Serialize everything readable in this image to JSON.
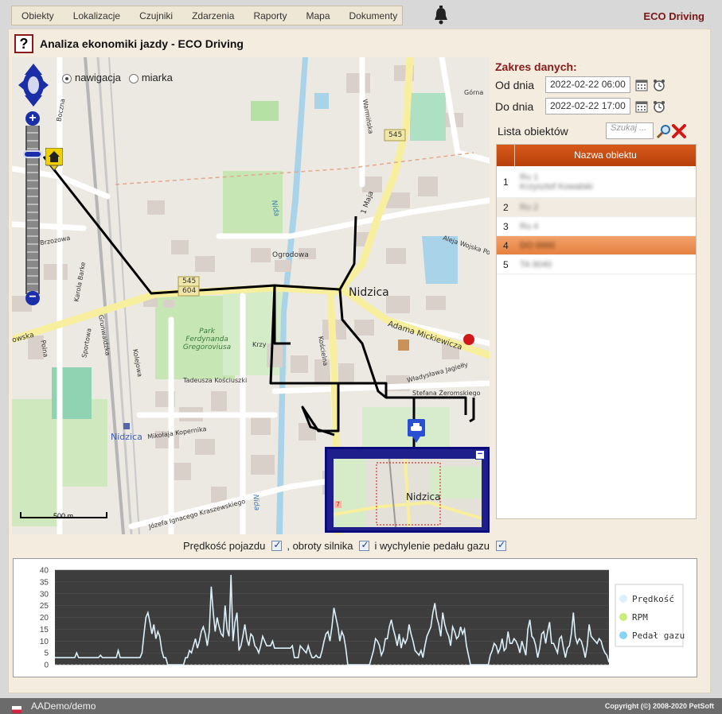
{
  "menu": {
    "items": [
      "Obiekty",
      "Lokalizacje",
      "Czujniki",
      "Zdarzenia",
      "Raporty",
      "Mapa",
      "Dokumenty"
    ]
  },
  "app_name": "ECO Driving",
  "page": {
    "help": "?",
    "title": "Analiza ekonomiki jazdy - ECO Driving"
  },
  "map": {
    "mode_navigation": "nawigacja",
    "mode_measure": "miarka",
    "labels": {
      "city": "Nidzica",
      "city_small": "Nidzica",
      "overview_city": "Nidzica",
      "road_545": "545",
      "road_545_b": "545",
      "road_604": "604",
      "ogrodowa": "Ogrodowa",
      "park": "Park Ferdynanda Gregoroviusa",
      "mickiewicza": "Adama Mickiewicza",
      "kosciuszki": "Tadeusza Kościuszki",
      "kopernika": "Mikołaja Kopernika",
      "jagielly": "Władysława Jagiełły",
      "zeromskiego": "Stefana Żeromskiego",
      "aleja": "Aleja Wojska Po",
      "nida": "Nida",
      "nida2": "Nida",
      "maja": "1 Maja",
      "gorna": "Górna",
      "warminska": "Warmińska",
      "kraszewskiego": "Józefa Ignacego Kraszewskiego",
      "brzozowa": "Brzozowa",
      "sportowa": "Sportowa",
      "grunwaldzka": "Grunwaldzka",
      "polna": "Polna",
      "kolejowa": "Kolejowa",
      "barke": "Karola Barke",
      "boczna": "Boczna",
      "krzy": "Krzy",
      "kosciena": "Kościelna",
      "rowska": "owska",
      "overview_badge": "7"
    },
    "scale": "500 m"
  },
  "range": {
    "title": "Zakres danych:",
    "from_label": "Od dnia",
    "from_value": "2022-02-22 06:00",
    "to_label": "Do dnia",
    "to_value": "2022-02-22 17:00"
  },
  "objects": {
    "label": "Lista obiektów",
    "search_placeholder": "Szukaj ...",
    "column_name": "Nazwa obiektu",
    "rows": [
      {
        "num": "1",
        "name": "Ru 1",
        "sub": "Krzysztof Kowalski"
      },
      {
        "num": "2",
        "name": "Ru 2",
        "sub": ""
      },
      {
        "num": "3",
        "name": "Ru 4",
        "sub": ""
      },
      {
        "num": "4",
        "name": "DO 0000",
        "sub": ""
      },
      {
        "num": "5",
        "name": "TA 9040",
        "sub": ""
      }
    ],
    "selected": "4"
  },
  "chart_options": {
    "speed": "Prędkość pojazdu",
    "rpm": ", obroty silnika",
    "pedal": "i wychylenie pedału gazu"
  },
  "chart_data": {
    "type": "line",
    "ylim": [
      0,
      40
    ],
    "yticks": [
      "40",
      "35",
      "30",
      "25",
      "20",
      "15",
      "10",
      "5",
      "0"
    ],
    "legend": [
      {
        "name": "Prędkość",
        "color": "#dcf0fa"
      },
      {
        "name": "RPM",
        "color": "#c9ec7a"
      },
      {
        "name": "Pedał gazu",
        "color": "#86d4f0"
      }
    ],
    "series": [
      {
        "name": "Prędkość",
        "values": [
          3,
          3,
          3,
          3,
          3,
          3,
          3,
          3,
          3,
          3,
          3,
          5,
          3,
          3,
          3,
          3,
          3,
          3,
          3,
          3,
          3,
          3,
          3,
          4,
          3,
          3,
          3,
          3,
          3,
          3,
          3,
          3,
          6,
          3,
          3,
          3,
          3,
          3,
          3,
          3,
          3,
          3,
          3,
          3,
          5,
          13,
          20,
          22,
          18,
          13,
          17,
          11,
          14,
          12,
          6,
          3,
          3,
          0,
          0,
          0,
          0,
          0,
          0,
          0,
          0,
          0,
          3,
          3,
          6,
          5,
          8,
          11,
          7,
          10,
          14,
          16,
          13,
          8,
          14,
          33,
          22,
          14,
          20,
          16,
          13,
          12,
          25,
          15,
          12,
          38,
          10,
          18,
          22,
          6,
          8,
          12,
          17,
          11,
          8,
          13,
          12,
          8,
          7,
          5,
          8,
          12,
          10,
          8,
          8,
          8,
          10,
          7,
          7,
          7,
          7,
          7,
          7,
          7,
          7,
          7,
          8,
          3,
          3,
          3,
          8,
          7,
          6,
          5,
          8,
          5,
          3,
          3,
          4,
          3,
          3,
          6,
          10,
          13,
          14,
          10,
          16,
          24,
          20,
          16,
          10,
          14,
          12,
          7,
          0,
          0,
          0,
          0,
          0,
          0,
          0,
          0,
          0,
          0,
          0,
          0,
          3,
          6,
          11,
          10,
          8,
          4,
          6,
          11,
          11,
          16,
          19,
          15,
          12,
          8,
          13,
          7,
          11,
          9,
          11,
          17,
          13,
          10,
          6,
          5,
          4,
          6,
          3,
          8,
          12,
          14,
          16,
          22,
          26,
          20,
          17,
          12,
          22,
          17,
          14,
          12,
          8,
          16,
          14,
          11,
          12,
          16,
          13,
          15,
          8,
          4,
          0,
          0,
          0,
          0,
          0,
          0,
          0,
          0,
          0,
          0,
          4,
          6,
          9,
          8,
          5,
          7,
          11,
          6,
          7,
          14,
          9,
          9,
          11,
          10,
          8,
          5,
          10,
          7,
          4,
          15,
          19,
          12,
          11,
          8,
          3,
          7,
          13,
          14,
          9,
          14,
          18,
          9,
          9,
          7,
          5,
          11,
          12,
          7,
          3,
          7,
          8,
          13,
          22,
          12,
          9,
          11,
          10,
          7,
          3,
          8,
          17,
          12,
          11,
          10,
          9,
          11,
          10,
          7,
          5,
          4,
          1
        ]
      }
    ]
  }
}
